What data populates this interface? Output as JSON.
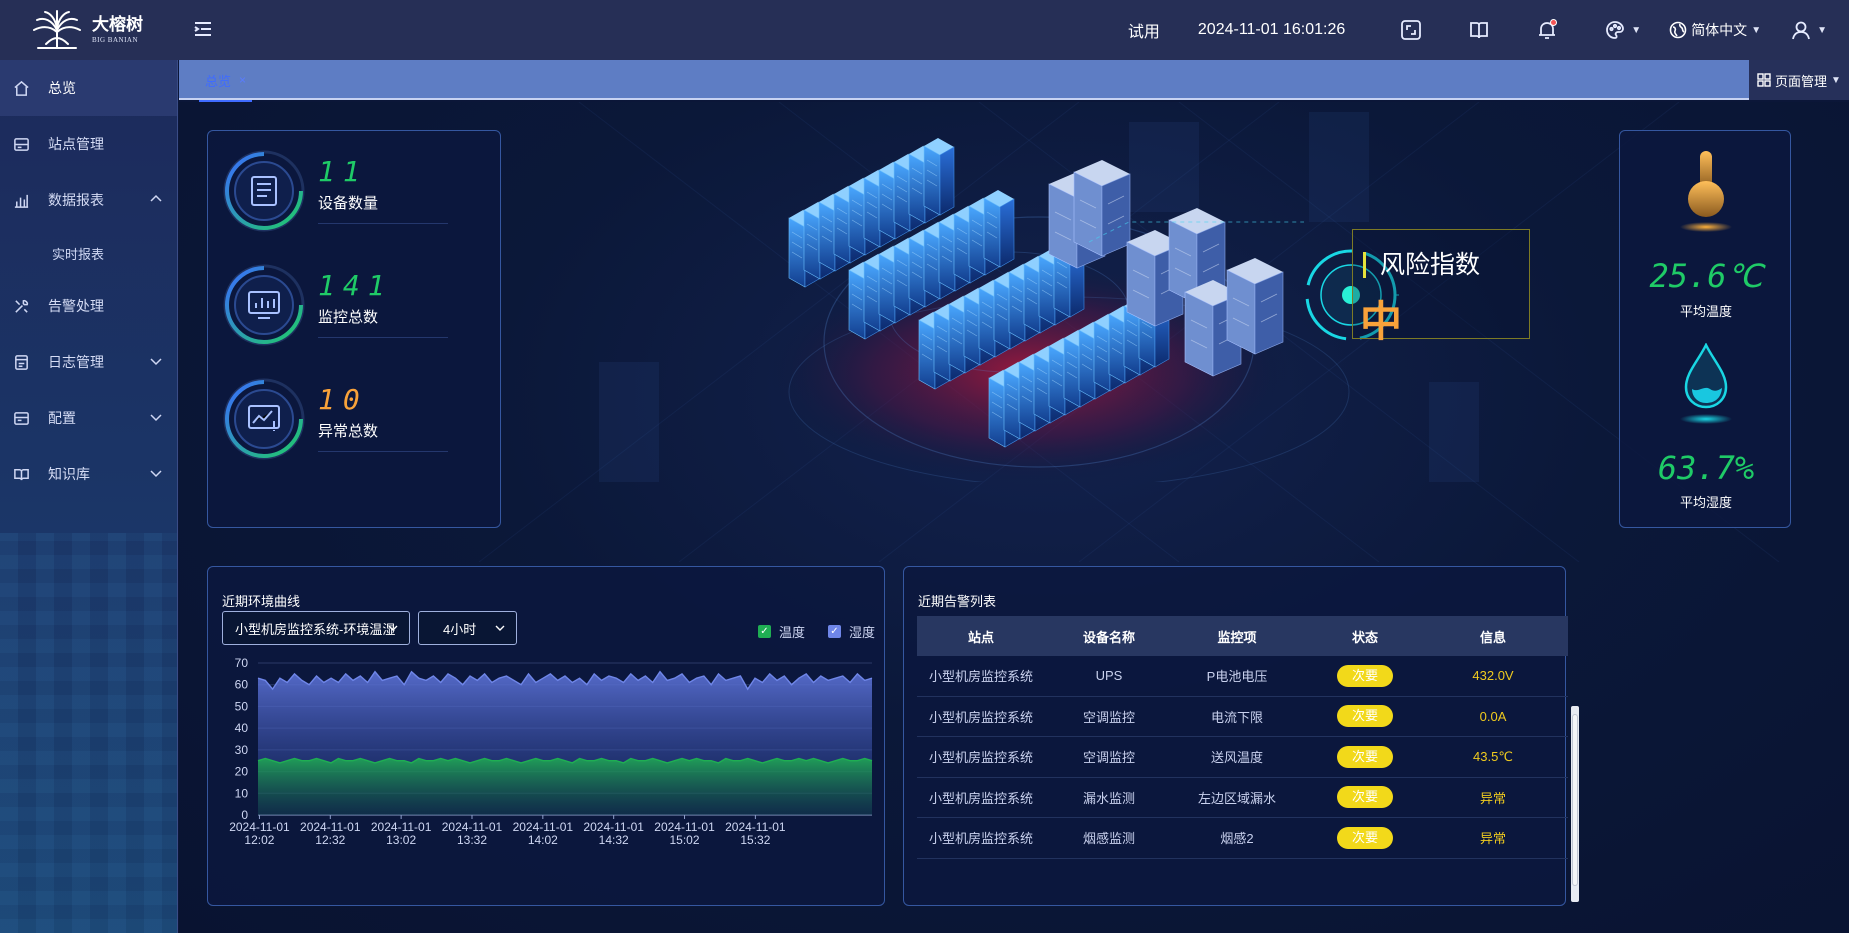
{
  "topbar": {
    "logo_cn": "大榕树",
    "logo_en": "BIG BANIAN",
    "trial": "试用",
    "datetime": "2024-11-01 16:01:26",
    "language": "简体中文",
    "icons": [
      "menu-fold-icon",
      "fullscreen-icon",
      "book-icon",
      "bell-icon",
      "palette-icon",
      "globe-icon",
      "user-icon"
    ]
  },
  "sidebar": {
    "items": [
      {
        "label": "总览",
        "icon": "home-icon"
      },
      {
        "label": "站点管理",
        "icon": "server-icon"
      },
      {
        "label": "数据报表",
        "icon": "bar-chart-icon"
      },
      {
        "label": "实时报表"
      },
      {
        "label": "告警处理",
        "icon": "tools-icon"
      },
      {
        "label": "日志管理",
        "icon": "log-icon"
      },
      {
        "label": "配置",
        "icon": "config-icon"
      },
      {
        "label": "知识库",
        "icon": "book-icon"
      }
    ]
  },
  "tabs": {
    "active": "总览",
    "close": "×",
    "page_manage": "页面管理"
  },
  "stats": [
    {
      "value": "11",
      "label": "设备数量",
      "color": "#1fcb67"
    },
    {
      "value": "141",
      "label": "监控总数",
      "color": "#1fcb67"
    },
    {
      "value": "10",
      "label": "异常总数",
      "color": "#f8a23a"
    }
  ],
  "risk": {
    "title": "风险指数",
    "level": "中"
  },
  "metrics": {
    "temp_value": "25.6℃",
    "temp_label": "平均温度",
    "humid_value": "63.7%",
    "humid_label": "平均湿度"
  },
  "env_chart": {
    "title": "近期环境曲线",
    "select_system": "小型机房监控系统-环境温湿",
    "select_range": "4小时",
    "legend": [
      "温度",
      "湿度"
    ]
  },
  "chart_data": {
    "type": "area",
    "x_ticks": [
      "2024-11-01 12:02",
      "2024-11-01 12:32",
      "2024-11-01 13:02",
      "2024-11-01 13:32",
      "2024-11-01 14:02",
      "2024-11-01 14:32",
      "2024-11-01 15:02",
      "2024-11-01 15:32"
    ],
    "ylim": [
      0,
      70
    ],
    "y_ticks": [
      0,
      10,
      20,
      30,
      40,
      50,
      60,
      70
    ],
    "series": [
      {
        "name": "湿度",
        "color": "#6f86e8",
        "values": [
          63,
          62,
          58,
          63,
          61,
          65,
          62,
          60,
          64,
          61,
          63,
          61,
          65,
          62,
          64,
          61,
          66,
          62,
          63,
          64,
          60,
          66,
          63,
          62,
          64,
          61,
          65,
          63,
          60,
          64,
          62,
          65,
          61,
          63,
          64,
          62,
          60,
          65,
          61,
          63,
          65,
          62,
          64,
          61,
          63,
          60,
          65,
          62,
          64,
          63,
          61,
          65,
          62,
          64,
          61,
          66,
          62,
          63,
          65,
          61,
          63,
          64,
          60,
          65,
          62,
          63,
          64,
          58,
          63,
          61,
          65,
          62,
          64,
          60,
          63,
          65,
          61,
          64,
          62,
          63,
          64,
          61,
          65,
          62,
          63
        ]
      },
      {
        "name": "温度",
        "color": "#1fae53",
        "values": [
          25,
          26,
          25,
          24,
          25,
          26,
          25,
          25,
          26,
          25,
          24,
          26,
          25,
          25,
          26,
          25,
          24,
          25,
          26,
          25,
          25,
          24,
          26,
          25,
          25,
          26,
          25,
          26,
          25,
          24,
          25,
          26,
          25,
          25,
          26,
          25,
          24,
          25,
          26,
          25,
          25,
          26,
          25,
          24,
          26,
          25,
          25,
          26,
          25,
          25,
          24,
          26,
          25,
          25,
          26,
          25,
          24,
          25,
          26,
          25,
          26,
          25,
          25,
          24,
          26,
          25,
          25,
          26,
          25,
          24,
          25,
          26,
          25,
          25,
          26,
          25,
          26,
          25,
          24,
          25,
          26,
          25,
          25,
          26,
          25
        ]
      }
    ]
  },
  "alarm": {
    "title": "近期告警列表",
    "headers": [
      "站点",
      "设备名称",
      "监控项",
      "状态",
      "信息"
    ],
    "rows": [
      [
        "小型机房监控系统",
        "UPS",
        "P电池电压",
        "次要",
        "432.0V"
      ],
      [
        "小型机房监控系统",
        "空调监控",
        "电流下限",
        "次要",
        "0.0A"
      ],
      [
        "小型机房监控系统",
        "空调监控",
        "送风温度",
        "次要",
        "43.5℃"
      ],
      [
        "小型机房监控系统",
        "漏水监测",
        "左边区域漏水",
        "次要",
        "异常"
      ],
      [
        "小型机房监控系统",
        "烟感监测",
        "烟感2",
        "次要",
        "异常"
      ]
    ]
  }
}
